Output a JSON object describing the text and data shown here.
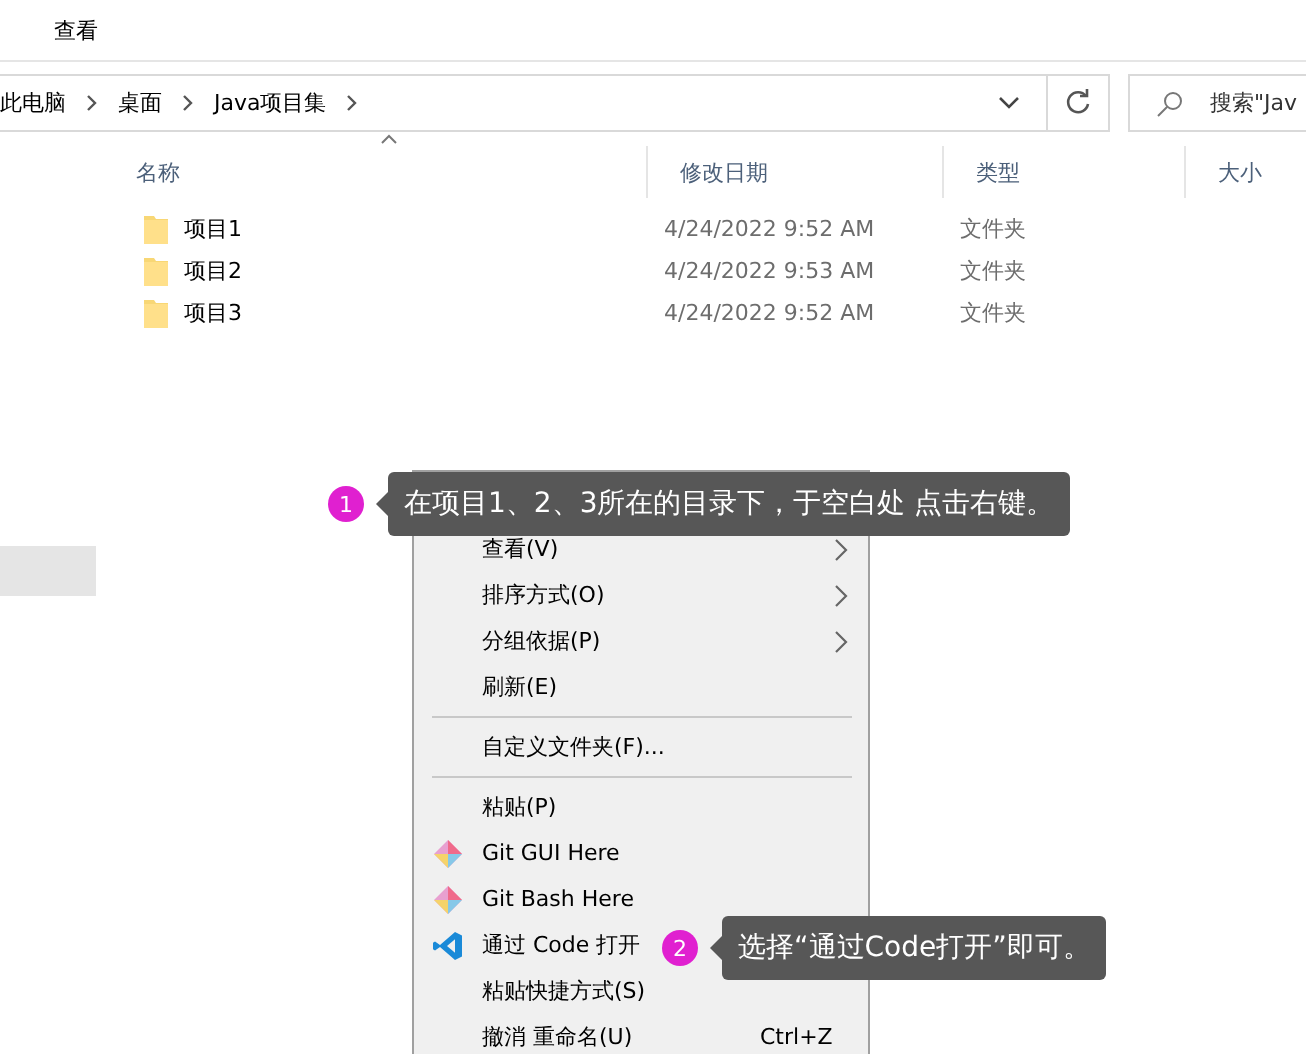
{
  "ribbon": {
    "tabs": [
      {
        "label": "查看",
        "selected": false
      }
    ]
  },
  "address_bar": {
    "crumbs": [
      "此电脑",
      "桌面",
      "Java项目集"
    ],
    "search": {
      "placeholder": "搜索\"Jav"
    }
  },
  "sidebar": {
    "items": [
      {
        "selected": true
      }
    ]
  },
  "table": {
    "columns": [
      "名称",
      "修改日期",
      "类型",
      "大小"
    ],
    "rows": [
      {
        "name": "项目1",
        "modified": "4/24/2022 9:52 AM",
        "type": "文件夹"
      },
      {
        "name": "项目2",
        "modified": "4/24/2022 9:53 AM",
        "type": "文件夹"
      },
      {
        "name": "项目3",
        "modified": "4/24/2022 9:52 AM",
        "type": "文件夹"
      }
    ]
  },
  "context_menu": {
    "items": [
      {
        "kind": "hidden"
      },
      {
        "kind": "item",
        "label": "查看(V)",
        "submenu": true
      },
      {
        "kind": "item",
        "label": "排序方式(O)",
        "submenu": true
      },
      {
        "kind": "item",
        "label": "分组依据(P)",
        "submenu": true
      },
      {
        "kind": "item",
        "label": "刷新(E)",
        "submenu": false
      },
      {
        "kind": "separator"
      },
      {
        "kind": "item",
        "label": "自定义文件夹(F)...",
        "submenu": false
      },
      {
        "kind": "separator"
      },
      {
        "kind": "item",
        "label": "粘贴(P)",
        "submenu": false
      },
      {
        "kind": "git",
        "label": "Git GUI Here",
        "submenu": false
      },
      {
        "kind": "git",
        "label": "Git Bash Here",
        "submenu": false
      },
      {
        "kind": "editor",
        "label": "通过 Code 打开"
      },
      {
        "kind": "item",
        "label": "粘贴快捷方式(S)",
        "submenu": false
      },
      {
        "kind": "item",
        "label": "撤消 重命名(U)",
        "shortcut": "Ctrl+Z",
        "submenu": false
      }
    ]
  },
  "callouts": [
    {
      "number": "1",
      "text": "在项目1、2、3所在的目录下，于空白处 点击右键。"
    },
    {
      "number": "2",
      "text": "选择“通过Code打开”即可。"
    }
  ]
}
